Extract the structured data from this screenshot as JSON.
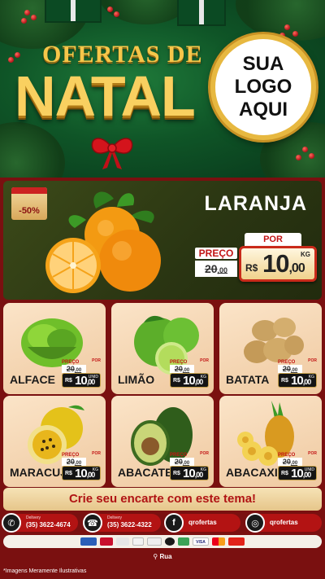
{
  "header": {
    "title_small": "OFERTAS DE",
    "title_big": "NATAL",
    "logo_lines": [
      "SUA",
      "LOGO",
      "AQUI"
    ]
  },
  "featured": {
    "badge": "-50%",
    "name": "LARANJA",
    "preco_label": "PREÇO",
    "old_price_int": "20",
    "old_price_dec": ",00",
    "por_label": "POR",
    "currency": "R$",
    "new_price_int": "10",
    "new_price_dec": ",00",
    "unit": "KG"
  },
  "products": [
    {
      "name": "ALFACE",
      "preco_label": "PREÇO",
      "old_int": "20",
      "old_dec": ",00",
      "currency": "R$",
      "new_int": "10",
      "new_dec": ",00",
      "unit": "UNID",
      "por_label": "POR"
    },
    {
      "name": "LIMÃO",
      "preco_label": "PREÇO",
      "old_int": "20",
      "old_dec": ",00",
      "currency": "R$",
      "new_int": "10",
      "new_dec": ",00",
      "unit": "KG",
      "por_label": "POR"
    },
    {
      "name": "BATATA",
      "preco_label": "PREÇO",
      "old_int": "20",
      "old_dec": ",00",
      "currency": "R$",
      "new_int": "10",
      "new_dec": ",00",
      "unit": "KG",
      "por_label": "POR"
    },
    {
      "name": "MARACUJÁ",
      "preco_label": "PREÇO",
      "old_int": "20",
      "old_dec": ",00",
      "currency": "R$",
      "new_int": "10",
      "new_dec": ",00",
      "unit": "KG",
      "por_label": "POR"
    },
    {
      "name": "ABACATE",
      "preco_label": "PREÇO",
      "old_int": "20",
      "old_dec": ",00",
      "currency": "R$",
      "new_int": "10",
      "new_dec": ",00",
      "unit": "KG",
      "por_label": "POR"
    },
    {
      "name": "ABACAXI",
      "preco_label": "PREÇO",
      "old_int": "20",
      "old_dec": ",00",
      "currency": "R$",
      "new_int": "10",
      "new_dec": ",00",
      "unit": "UNID",
      "por_label": "POR"
    }
  ],
  "cta": "Crie seu encarte com este tema!",
  "contacts": {
    "whatsapp_label": "Delivery",
    "whatsapp_number": "(35) 3622-4674",
    "phone_label": "Delivery",
    "phone_number": "(35) 3622-4322",
    "facebook": "qrofertas",
    "instagram": "qrofertas"
  },
  "payments": [
    "",
    "",
    "",
    "",
    "",
    "",
    "",
    "VISA",
    ""
  ],
  "address": "Rua",
  "note": "*Imagens Meramente Ilustrativas"
}
